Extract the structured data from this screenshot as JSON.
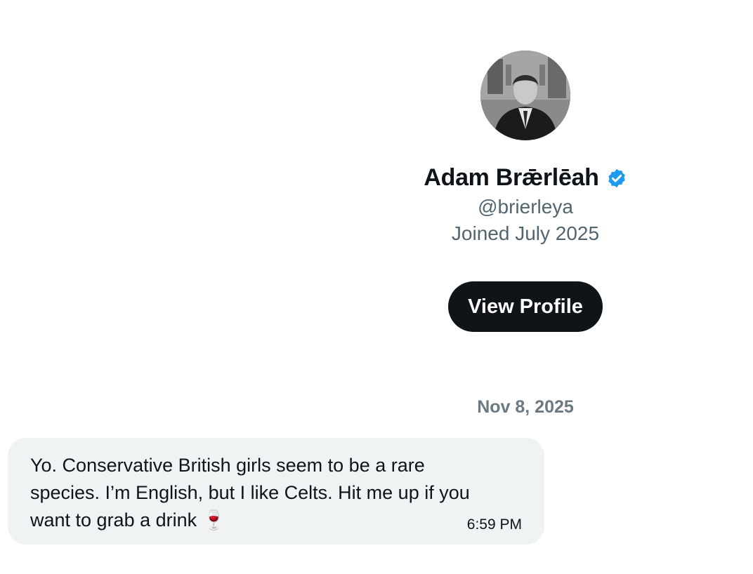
{
  "profile": {
    "display_name": "Adam Brǣrlēah",
    "handle": "@brierleya",
    "joined": "Joined July 2025",
    "view_profile_label": "View Profile",
    "verified_color": "#1d9bf0",
    "avatar_icon": "avatar-photo"
  },
  "conversation": {
    "date": "Nov 8, 2025",
    "messages": [
      {
        "text": "Yo. Conservative British girls seem to be a rare species. I’m English, but I like Celts. Hit me up if you want to grab a drink 🍷",
        "time": "6:59 PM"
      }
    ]
  },
  "colors": {
    "button_bg": "#0f1419",
    "bubble_bg": "#eff3f4",
    "secondary_text": "#536471"
  }
}
